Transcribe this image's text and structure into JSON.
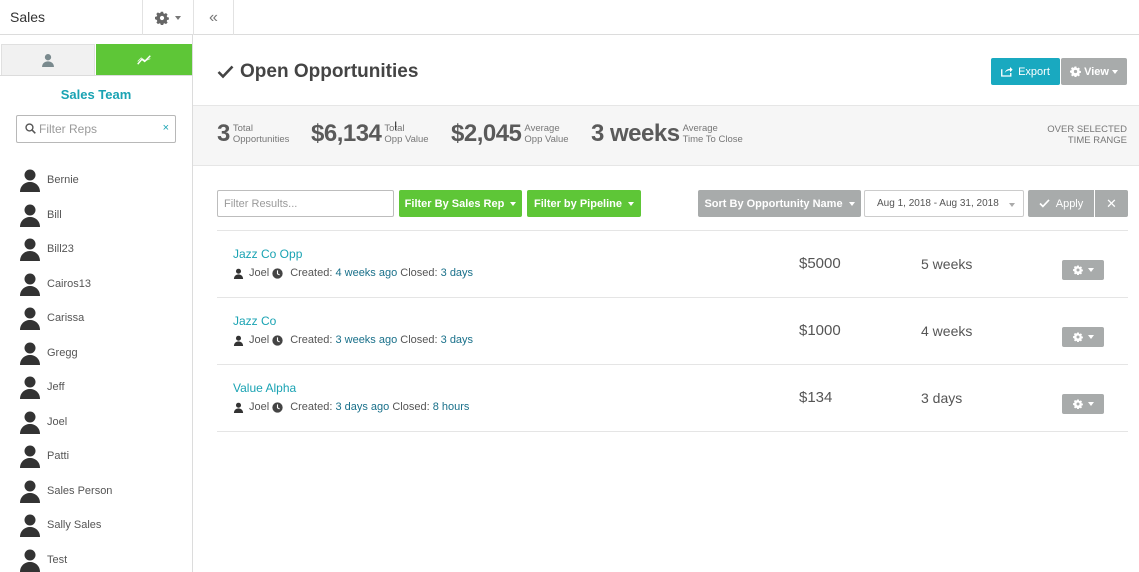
{
  "app": {
    "title": "Sales"
  },
  "sidebar": {
    "team_title": "Sales Team",
    "filter_placeholder": "Filter Reps",
    "filter_clear": "×",
    "reps": [
      "Bernie",
      "Bill",
      "Bill23",
      "Cairos13",
      "Carissa",
      "Gregg",
      "Jeff",
      "Joel",
      "Patti",
      "Sales Person",
      "Sally Sales",
      "Test"
    ]
  },
  "header": {
    "title": "Open Opportunities",
    "export_label": "Export",
    "view_label": "View"
  },
  "stats": {
    "total_opps": {
      "value": "3",
      "label1": "Total",
      "label2": "Opportunities"
    },
    "opp_value": {
      "value": "$6,134",
      "label1": "Total",
      "label2": "Opp Value"
    },
    "avg_value": {
      "value": "$2,045",
      "label1": "Average",
      "label2": "Opp Value"
    },
    "avg_time": {
      "value": "3 weeks",
      "label1": "Average",
      "label2": "Time To Close"
    },
    "range_note1": "OVER SELECTED",
    "range_note2": "TIME RANGE"
  },
  "filters": {
    "results_placeholder": "Filter Results...",
    "by_rep_label": "Filter By Sales Rep",
    "by_pipeline_label": "Filter by Pipeline",
    "sort_label": "Sort By Opportunity Name",
    "date_range": "Aug 1, 2018 - Aug 31, 2018",
    "apply_label": "Apply",
    "clear_label": "✕"
  },
  "opportunities": [
    {
      "name": "Jazz Co Opp",
      "owner": "Joel",
      "created_label": "Created:",
      "created": "4 weeks ago",
      "closed_label": "Closed:",
      "closed": "3 days",
      "value": "$5000",
      "duration": "5 weeks"
    },
    {
      "name": "Jazz Co",
      "owner": "Joel",
      "created_label": "Created:",
      "created": "3 weeks ago",
      "closed_label": "Closed:",
      "closed": "3 days",
      "value": "$1000",
      "duration": "4 weeks"
    },
    {
      "name": "Value Alpha",
      "owner": "Joel",
      "created_label": "Created:",
      "created": "3 days ago",
      "closed_label": "Closed:",
      "closed": "8 hours",
      "value": "$134",
      "duration": "3 days"
    }
  ],
  "colors": {
    "accent": "#1aa3b3",
    "green": "#5ec637",
    "gray_button": "#a8abab",
    "export": "#19a9c0"
  }
}
